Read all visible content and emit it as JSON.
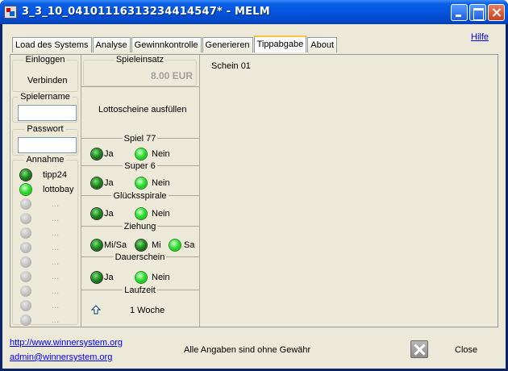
{
  "window": {
    "title": "3_3_10_04101116313234414547* - MELM"
  },
  "tabs": [
    "Load des Systems",
    "Analyse",
    "Gewinnkontrolle",
    "Generieren",
    "Tippabgabe",
    "About"
  ],
  "active_tab": "Tippabgabe",
  "help_link": "Hilfe",
  "login": {
    "group_label": "Einloggen",
    "connect_label": "Verbinden",
    "username_label": "Spielername",
    "username_value": "",
    "password_label": "Passwort",
    "password_value": ""
  },
  "acceptance": {
    "group_label": "Annahme",
    "items": [
      {
        "label": "tipp24",
        "status": "dark"
      },
      {
        "label": "lottobay",
        "status": "bright"
      },
      {
        "label": "...",
        "status": "grey"
      },
      {
        "label": "...",
        "status": "grey"
      },
      {
        "label": "...",
        "status": "grey"
      },
      {
        "label": "...",
        "status": "grey"
      },
      {
        "label": "...",
        "status": "grey"
      },
      {
        "label": "...",
        "status": "grey"
      },
      {
        "label": "...",
        "status": "grey"
      },
      {
        "label": "...",
        "status": "grey"
      },
      {
        "label": "...",
        "status": "grey"
      }
    ]
  },
  "stake": {
    "label": "Spieleinsatz",
    "value": "8.00 EUR"
  },
  "fill_tickets": "Lottoscheine ausfüllen",
  "options": {
    "spiel77": {
      "label": "Spiel 77",
      "ja": "Ja",
      "nein": "Nein"
    },
    "super6": {
      "label": "Super 6",
      "ja": "Ja",
      "nein": "Nein"
    },
    "gluecksspirale": {
      "label": "Glücksspirale",
      "ja": "Ja",
      "nein": "Nein"
    },
    "ziehung": {
      "label": "Ziehung",
      "mi_sa": "Mi/Sa",
      "mi": "Mi",
      "sa": "Sa"
    },
    "dauerschein": {
      "label": "Dauerschein",
      "ja": "Ja",
      "nein": "Nein"
    },
    "laufzeit": {
      "label": "Laufzeit",
      "value": "1 Woche"
    }
  },
  "ticket": {
    "title": "Schein 01"
  },
  "footer": {
    "website": "http://www.winnersystem.org",
    "email": "admin@winnersystem.org",
    "disclaimer": "Alle Angaben sind ohne Gewähr",
    "close_label": "Close"
  },
  "colors": {
    "titlebar": "#0555e0",
    "face": "#ece9d8",
    "led_on": "#32e032",
    "led_off": "#1f8c1f",
    "stake_text": "#a0a0a0"
  }
}
